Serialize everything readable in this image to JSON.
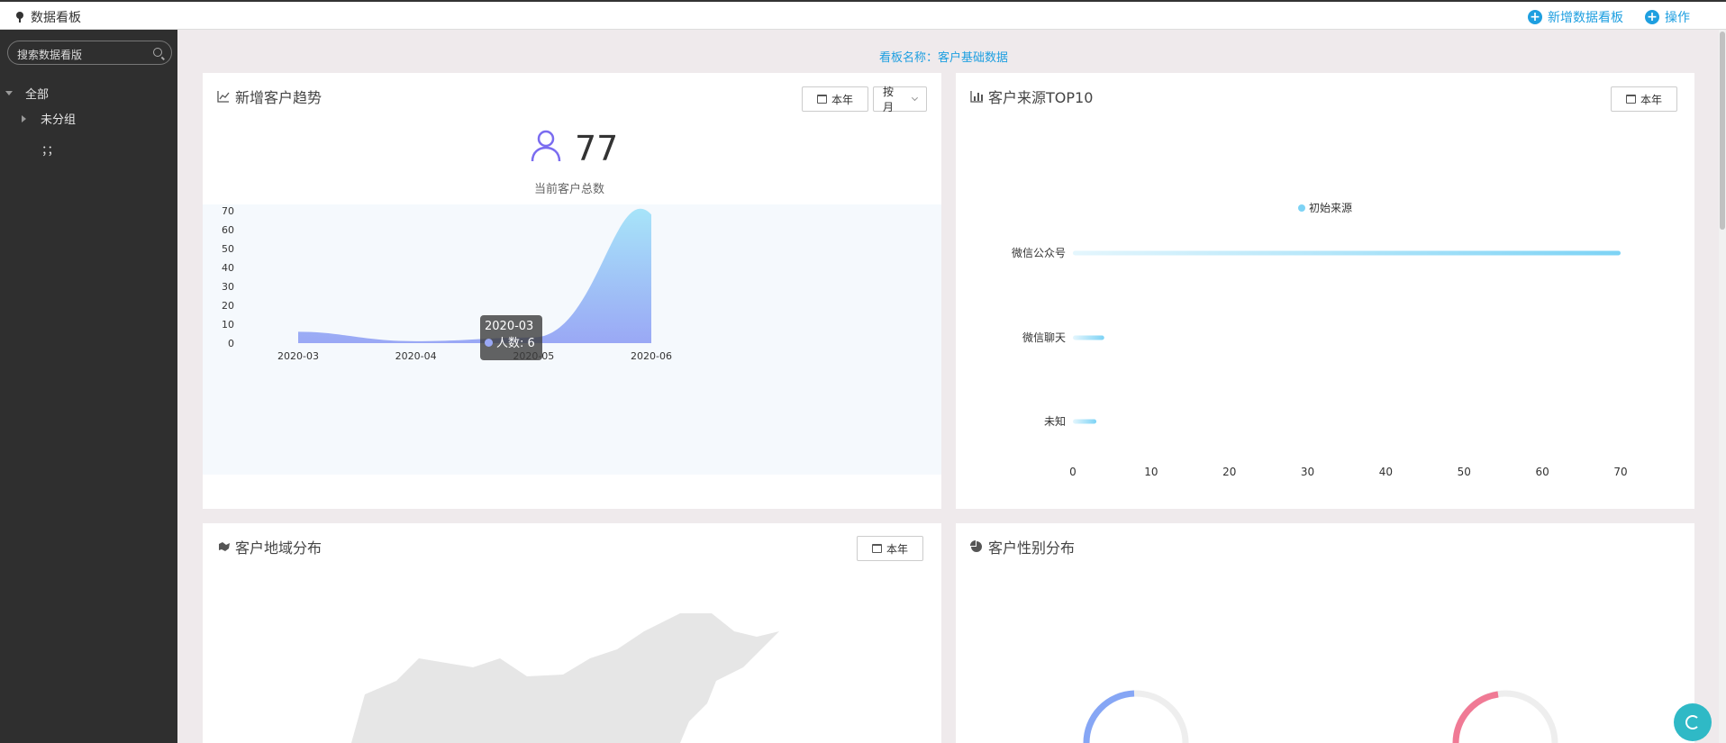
{
  "topbar": {
    "title": "数据看板",
    "add_board_label": "新增数据看板",
    "operate_label": "操作"
  },
  "sidebar": {
    "search_placeholder": "搜索数据看版",
    "tree": [
      {
        "label": "全部"
      },
      {
        "label": "未分组"
      },
      {
        "label": "；；"
      }
    ]
  },
  "board_name": "看板名称：客户基础数据",
  "trend_panel": {
    "title": "新增客户趋势",
    "year_btn": "本年",
    "period_btn": "按月",
    "total": "77",
    "total_label": "当前客户总数",
    "tooltip": {
      "date": "2020-03",
      "label": "人数: 6"
    },
    "icon": "user-icon",
    "chart_data": {
      "type": "area",
      "x": [
        "2020-03",
        "2020-04",
        "2020-05",
        "2020-06"
      ],
      "series": [
        {
          "name": "人数",
          "values": [
            6,
            1,
            3,
            68
          ]
        }
      ],
      "yticks": [
        "0",
        "10",
        "20",
        "30",
        "40",
        "50",
        "60",
        "70"
      ],
      "ylim": [
        0,
        70
      ]
    }
  },
  "source_panel": {
    "title": "客户来源TOP10",
    "year_btn": "本年",
    "chart_data": {
      "type": "bar",
      "orientation": "horizontal",
      "categories": [
        "微信公众号",
        "微信聊天",
        "未知"
      ],
      "series": [
        {
          "name": "初始来源",
          "values": [
            70,
            4,
            3
          ]
        }
      ],
      "xticks": [
        "0",
        "10",
        "20",
        "30",
        "40",
        "50",
        "60",
        "70"
      ],
      "xlim": [
        0,
        70
      ]
    }
  },
  "region_panel": {
    "title": "客户地域分布",
    "year_btn": "本年"
  },
  "gender_panel": {
    "title": "客户性别分布"
  },
  "colors": {
    "accent": "#1e9fe0",
    "sidebar_bg": "#2f2f2f",
    "area_fill": "#9aa8f5",
    "bar_fill": "#7dd3f5"
  }
}
